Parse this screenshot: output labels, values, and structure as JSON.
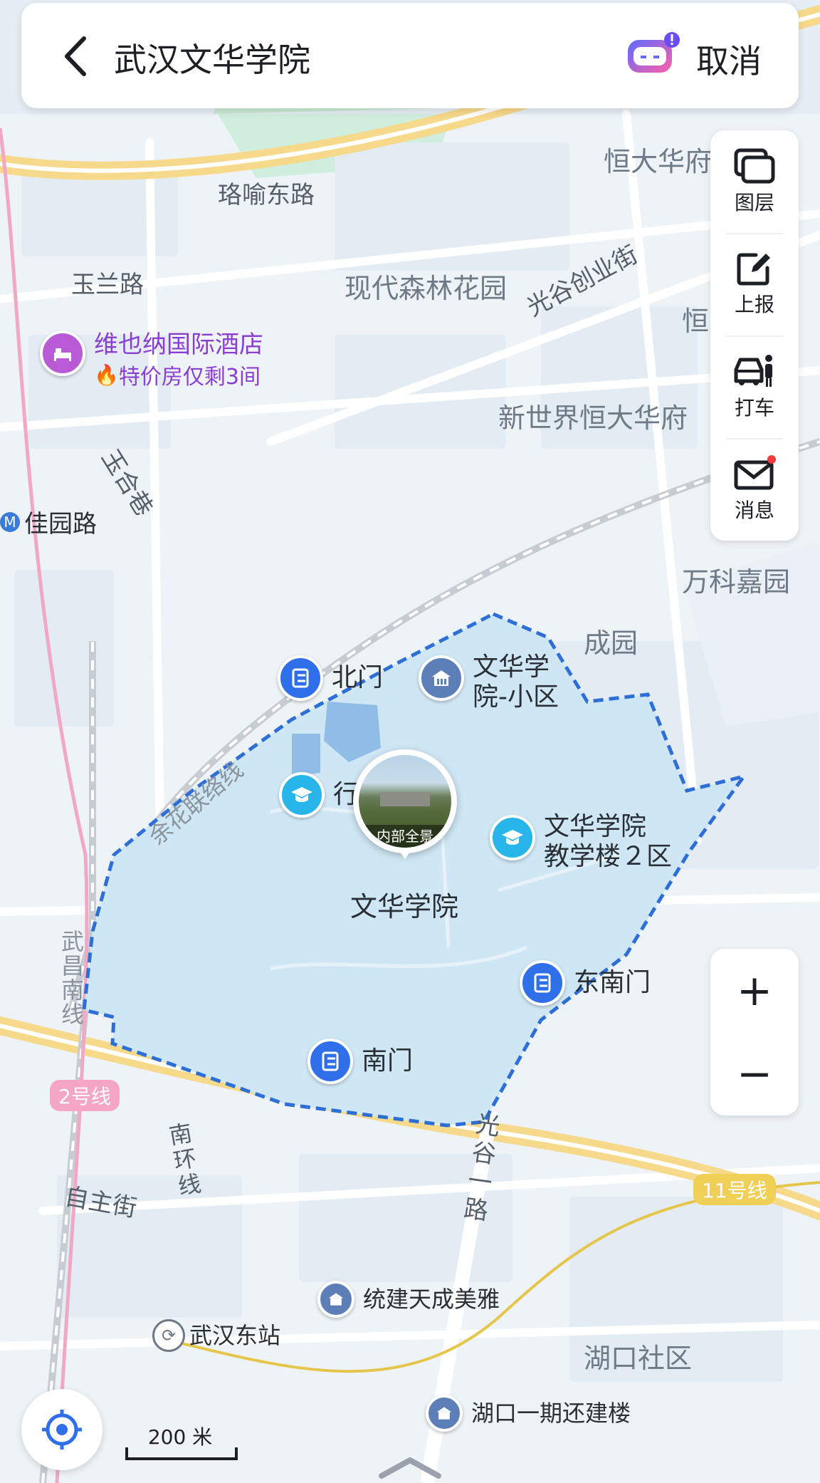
{
  "header": {
    "title": "武汉文华学院",
    "cancel_label": "取消"
  },
  "tools": [
    {
      "label": "图层",
      "icon": "layers-icon"
    },
    {
      "label": "上报",
      "icon": "report-icon"
    },
    {
      "label": "打车",
      "icon": "taxi-icon"
    },
    {
      "label": "消息",
      "icon": "mail-icon"
    }
  ],
  "zoom": {
    "in_label": "+",
    "out_label": "−"
  },
  "scale": {
    "label": "200 米"
  },
  "campus": {
    "name": "文华学院",
    "panorama_caption": "内部全景",
    "fill_color": "#cfe7f5",
    "border_color": "#2d6fd6"
  },
  "pois": {
    "north_gate": "北门",
    "southeast_gate": "东南门",
    "south_gate": "南门",
    "xiaoqu_line1": "文华学",
    "xiaoqu_line2": "院-小区",
    "teaching_line1": "文华学院",
    "teaching_line2": "教学楼２区",
    "admin_partial": "行",
    "hotel_name": "维也纳国际酒店",
    "hotel_promo": "特价房仅剩3间",
    "tongjian": "统建天成美雅",
    "hukou_phase1": "湖口一期还建楼",
    "wuhan_east": "武汉东站",
    "jiayuan": "佳园路"
  },
  "map_labels": {
    "luoyu": "珞喻东路",
    "yulan": "玉兰路",
    "forest": "现代森林花园",
    "guanggu_chuangye": "光谷创业街",
    "hengda_top": "恒大华府",
    "heng_partial": "恒",
    "xinshijie": "新世界恒大华府",
    "yuhe": "玉合巷",
    "vanke": "万科嘉园",
    "chengyuan": "成园",
    "yuhua_line": "余花联络线",
    "wuchang_south": "武昌南线",
    "line2": "2号线",
    "line11": "11号线",
    "nanhuan": "南环线",
    "zizhu": "自主街",
    "guanggu_1": "光谷一路",
    "hukou": "湖口社区"
  }
}
